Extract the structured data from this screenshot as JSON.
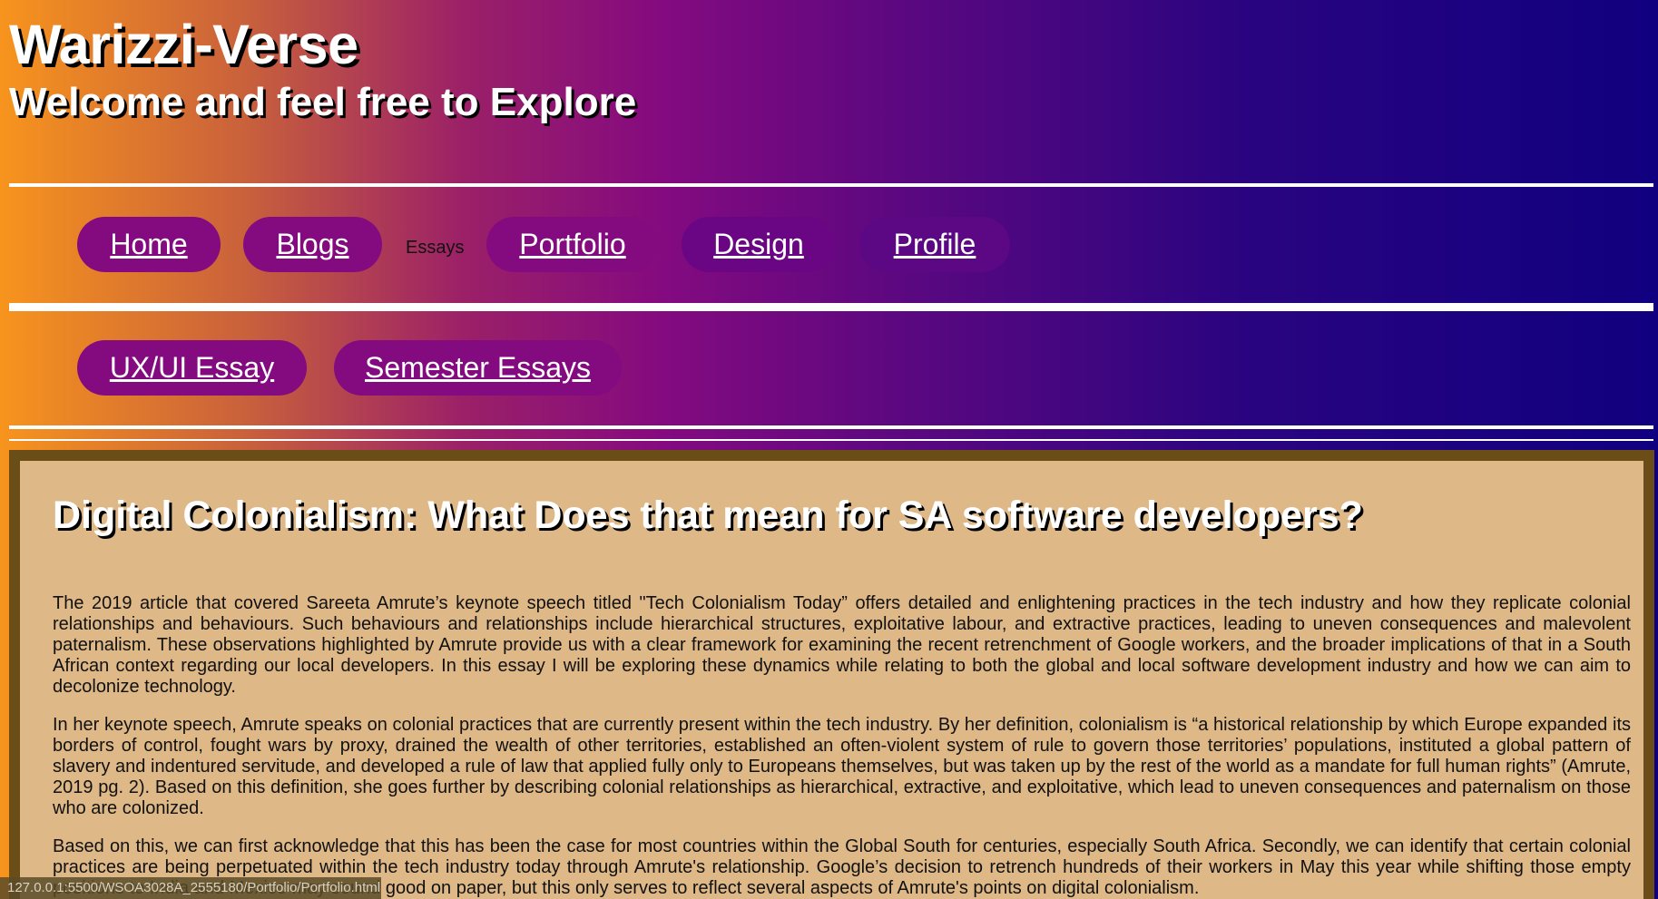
{
  "header": {
    "site_title": "Warizzi-Verse",
    "tagline": "Welcome and feel free to Explore"
  },
  "nav": {
    "home": "Home",
    "blogs": "Blogs",
    "essays": "Essays",
    "portfolio": "Portfolio",
    "design": "Design",
    "profile": "Profile"
  },
  "subnav": {
    "ux_essay": "UX/UI Essay",
    "semester_essays": "Semester Essays"
  },
  "article": {
    "title": "Digital Colonialism: What Does that mean for SA software developers?",
    "paragraphs": [
      "The 2019 article that covered Sareeta Amrute’s keynote speech titled \"Tech Colonialism Today” offers detailed and enlightening practices in the tech industry and how they replicate colonial relationships and behaviours. Such behaviours and relationships include hierarchical structures, exploitative labour, and extractive practices, leading to uneven consequences and malevolent paternalism. These observations highlighted by Amrute provide us with a clear framework for examining the recent retrenchment of Google workers, and the broader implications of that in a South African context regarding our local developers. In this essay I will be exploring these dynamics while relating to both the global and local software development industry and how we can aim to decolonize technology.",
      "In her keynote speech, Amrute speaks on colonial practices that are currently present within the tech industry. By her definition, colonialism is “a historical relationship by which Europe expanded its borders of control, fought wars by proxy, drained the wealth of other territories, established an often-violent system of rule to govern those territories’ populations, instituted a global pattern of slavery and indentured servitude, and developed a rule of law that applied fully only to Europeans themselves, but was taken up by the rest of the world as a mandate for full human rights” (Amrute, 2019 pg. 2). Based on this definition, she goes further by describing colonial relationships as hierarchical, extractive, and exploitative, which lead to uneven consequences and paternalism on those who are colonized.",
      "Based on this, we can first acknowledge that this has been the case for most countries within the Global South for centuries, especially South Africa. Secondly, we can identify that certain colonial practices are being perpetuated within the tech industry today through Amrute's relationship. Google’s decision to retrench hundreds of their workers in May this year while shifting those empty positions to India and Mexico may sound good on paper, but this only serves to reflect several aspects of Amrute's points on digital colonialism."
    ]
  },
  "status_bar": {
    "url": "127.0.0.1:5500/WSOA3028A_2555180/Portfolio/Portfolio.html"
  }
}
